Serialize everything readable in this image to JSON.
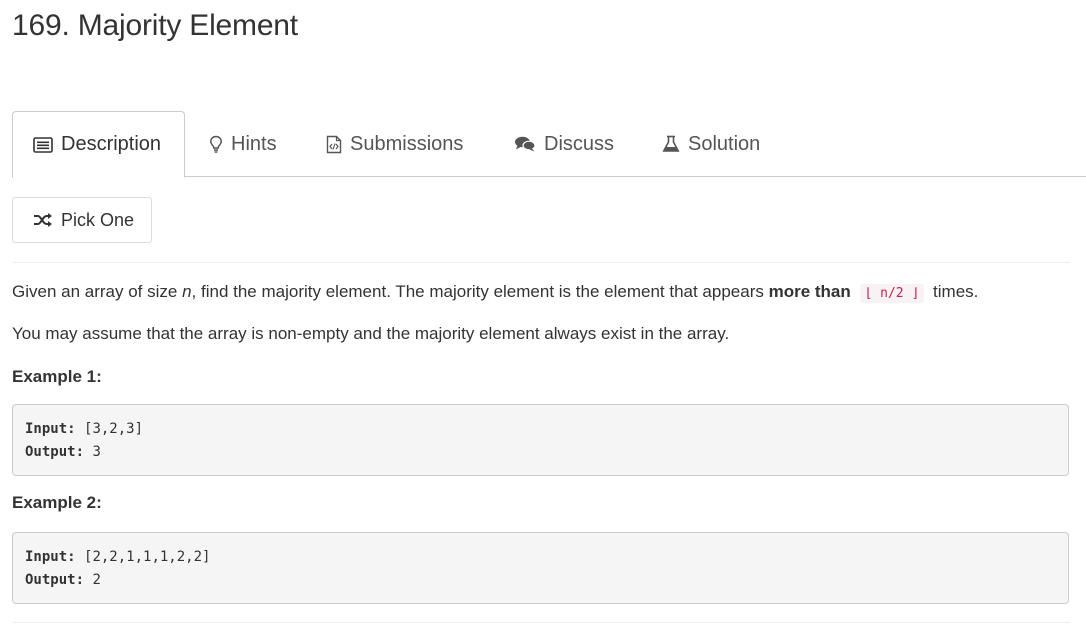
{
  "problem": {
    "title": "169. Majority Element"
  },
  "tabs": [
    {
      "label": "Description",
      "icon": "list-icon",
      "active": true
    },
    {
      "label": "Hints",
      "icon": "lightbulb-icon",
      "active": false
    },
    {
      "label": "Submissions",
      "icon": "code-file-icon",
      "active": false
    },
    {
      "label": "Discuss",
      "icon": "comments-icon",
      "active": false
    },
    {
      "label": "Solution",
      "icon": "flask-icon",
      "active": false
    }
  ],
  "pick_one": {
    "label": "Pick One",
    "icon": "shuffle-icon"
  },
  "description": {
    "line1_part1": "Given an array of size ",
    "line1_var": "n",
    "line1_part2": ", find the majority element. The majority element is the element that appears ",
    "line1_bold": "more than",
    "line1_code": "⌊ n/2 ⌋",
    "line1_part3": "times.",
    "line2": "You may assume that the array is non-empty and the majority element always exist in the array."
  },
  "examples": [
    {
      "title": "Example 1:",
      "input_label": "Input:",
      "input_value": "[3,2,3]",
      "output_label": "Output:",
      "output_value": "3"
    },
    {
      "title": "Example 2:",
      "input_label": "Input:",
      "input_value": "[2,2,1,1,1,2,2]",
      "output_label": "Output:",
      "output_value": "2"
    }
  ]
}
